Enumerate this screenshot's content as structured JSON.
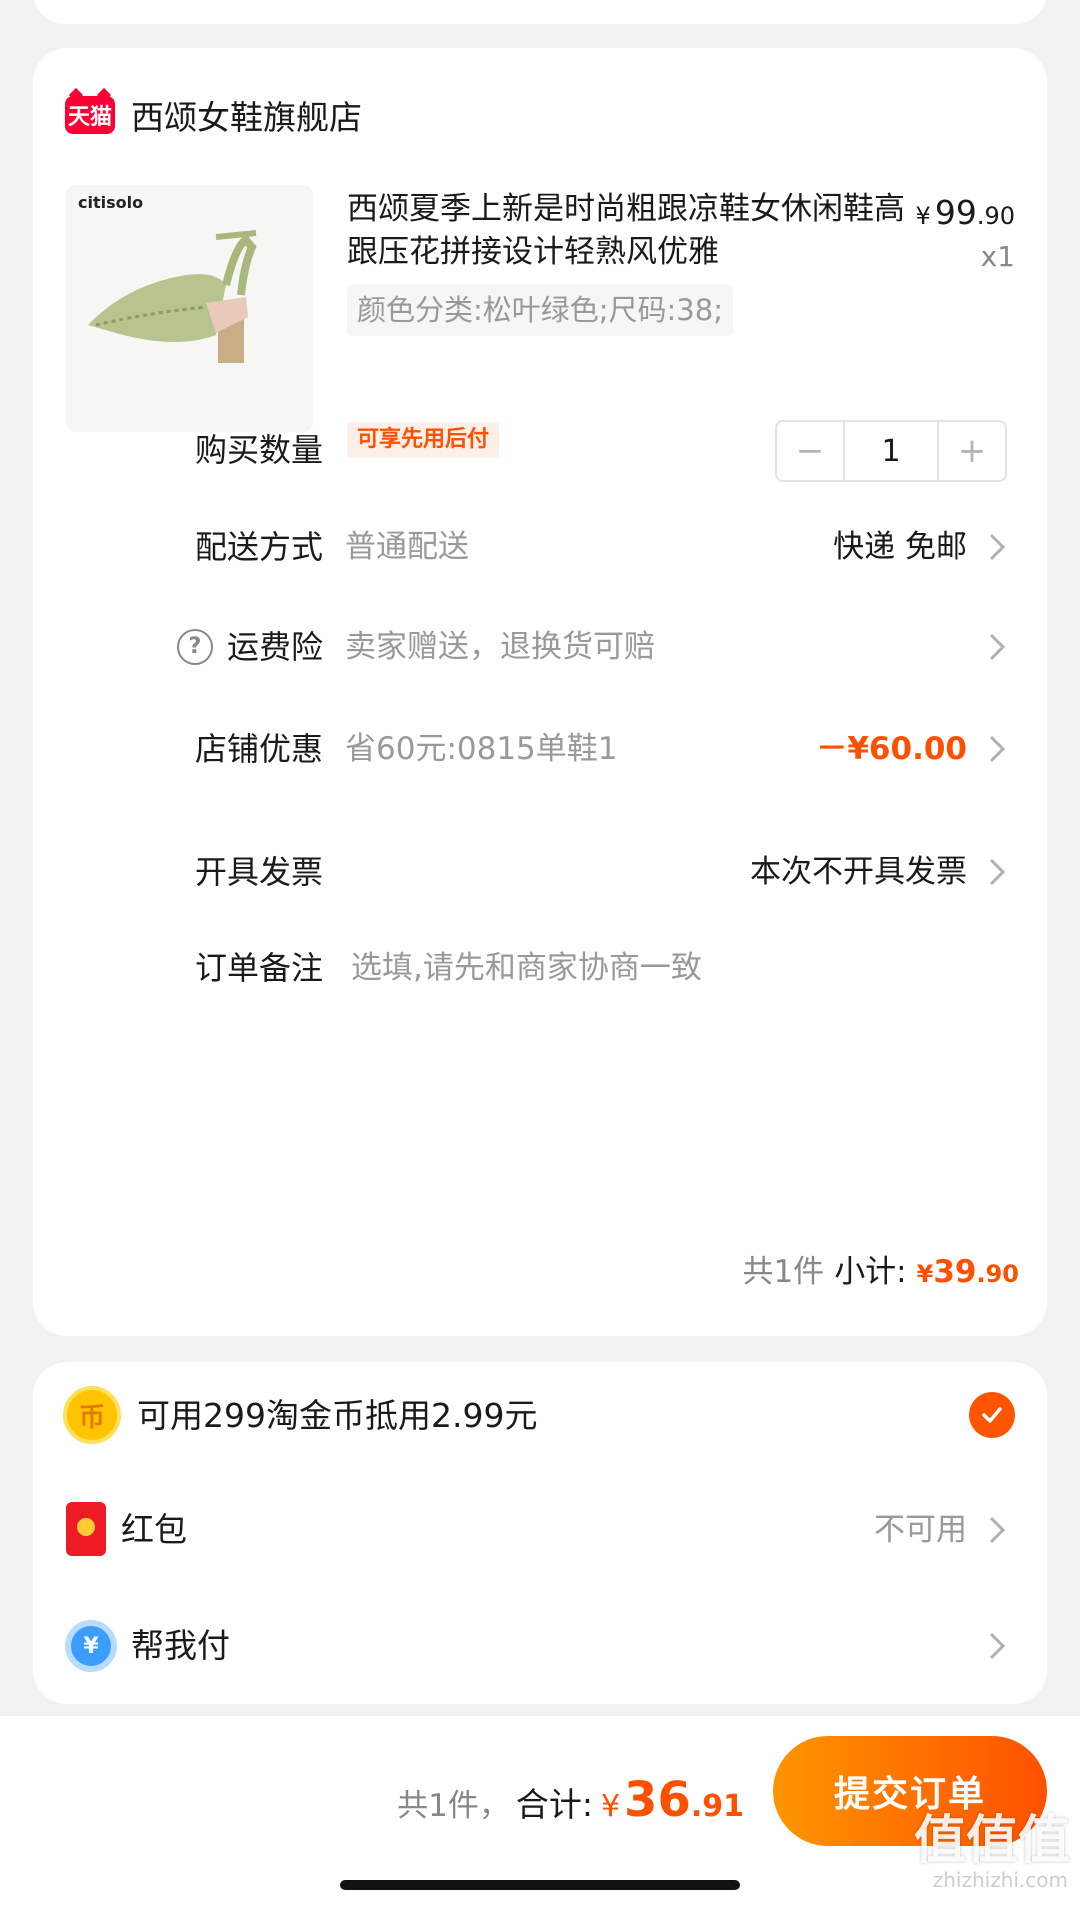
{
  "store": {
    "logo_text": "天猫",
    "name": "西颂女鞋旗舰店"
  },
  "product": {
    "brand_on_image": "citisolo",
    "title": "西颂夏季上新是时尚粗跟凉鞋女休闲鞋高跟压花拼接设计轻熟风优雅",
    "price_symbol": "¥",
    "price_int": "99",
    "price_dec": ".90",
    "quantity": "x1",
    "sku": "颜色分类:松叶绿色;尺码:38;",
    "bnpl_tag": "可享先用后付"
  },
  "order_rows": {
    "quantity": {
      "label": "购买数量",
      "minus": "−",
      "value": "1",
      "plus": "+"
    },
    "delivery": {
      "label": "配送方式",
      "sub": "普通配送",
      "value": "快递 免邮"
    },
    "insurance": {
      "label": "运费险",
      "help": "?",
      "sub": "卖家赠送，退换货可赔"
    },
    "discount": {
      "label": "店铺优惠",
      "sub": "省60元:0815单鞋1",
      "value": "－¥60.00"
    },
    "invoice": {
      "label": "开具发票",
      "value": "本次不开具发票"
    },
    "note": {
      "label": "订单备注",
      "placeholder": "选填,请先和商家协商一致"
    }
  },
  "subtotal": {
    "count": "共1件",
    "label": "小计:",
    "yen": "¥",
    "int": "39",
    "dec": ".90"
  },
  "payment_options": {
    "coins": {
      "icon_text": "币",
      "label": "可用299淘金币抵用2.99元",
      "checked": true
    },
    "red_packet": {
      "label": "红包",
      "value": "不可用"
    },
    "help_pay": {
      "icon_text": "¥",
      "label": "帮我付"
    }
  },
  "footer": {
    "count": "共1件，",
    "label": "合计:",
    "yen": "¥",
    "int": "36",
    "dec": ".91",
    "submit_label": "提交订单"
  },
  "watermark": {
    "text": "值值值",
    "sub": "zhizhizhi.com"
  },
  "colors": {
    "accent": "#ff5000",
    "tmall_red": "#ff0036",
    "muted": "#999999"
  }
}
